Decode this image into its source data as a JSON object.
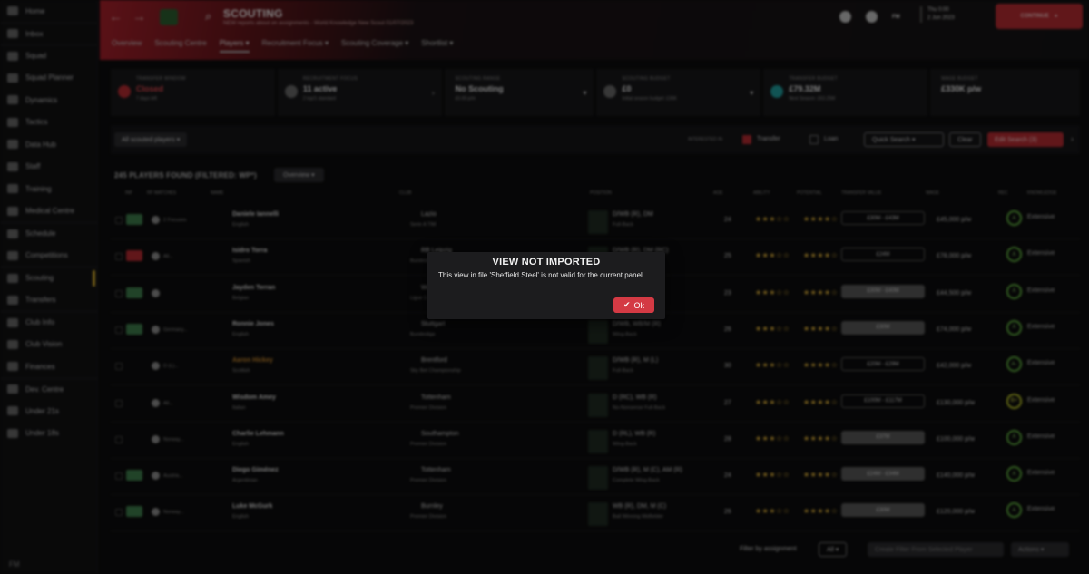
{
  "sidebar": {
    "items": [
      {
        "label": "Home",
        "icon": "home-icon"
      },
      {
        "label": "Inbox",
        "icon": "inbox-icon"
      },
      {
        "label": "Squad",
        "icon": "shirt-icon"
      },
      {
        "label": "Squad Planner",
        "icon": "planner-icon"
      },
      {
        "label": "Dynamics",
        "icon": "dynamics-icon"
      },
      {
        "label": "Tactics",
        "icon": "tactics-icon"
      },
      {
        "label": "Data Hub",
        "icon": "data-hub-icon"
      },
      {
        "label": "Staff",
        "icon": "staff-icon"
      },
      {
        "label": "Training",
        "icon": "training-icon"
      },
      {
        "label": "Medical Centre",
        "icon": "medical-icon"
      },
      {
        "label": "Schedule",
        "icon": "calendar-icon"
      },
      {
        "label": "Competitions",
        "icon": "trophy-icon"
      },
      {
        "label": "Scouting",
        "icon": "search-icon"
      },
      {
        "label": "Transfers",
        "icon": "transfers-icon"
      },
      {
        "label": "Club Info",
        "icon": "club-info-icon"
      },
      {
        "label": "Club Vision",
        "icon": "vision-icon"
      },
      {
        "label": "Finances",
        "icon": "finances-icon"
      },
      {
        "label": "Dev. Centre",
        "icon": "dev-centre-icon"
      },
      {
        "label": "Under 21s",
        "icon": "under21-icon"
      },
      {
        "label": "Under 18s",
        "icon": "under18-icon"
      }
    ],
    "footer": "FM"
  },
  "header": {
    "title": "SCOUTING",
    "subtitle": "NEW reports about on assignments - World Knowledge New Scout 01/07/2023",
    "abbr": "FM",
    "date_line1": "Thu 0:00",
    "date_line2": "2 Jun 2023",
    "continue_label": "CONTINUE"
  },
  "tabs": [
    "Overview",
    "Scouting Centre",
    "Players ▾",
    "Recruitment Focus ▾",
    "Scouting Coverage ▾",
    "Shortlist ▾"
  ],
  "cards": [
    {
      "label": "Transfer Window",
      "value": "Closed",
      "sub": "7 days left"
    },
    {
      "label": "Recruitment Focus",
      "value": "11 active",
      "sub": "2 top/1 standard"
    },
    {
      "label": "Scouting Range",
      "value": "No Scouting",
      "sub": "£0.00 p/m"
    },
    {
      "label": "Scouting Budget",
      "value": "£0",
      "sub": "Initial season budget: £36K"
    },
    {
      "label": "Transfer Budget",
      "value": "£79.32M",
      "sub": "Next Season: £63.25M"
    },
    {
      "label": "Wage Budget",
      "value": "£330K p/w",
      "sub": ""
    }
  ],
  "filters": {
    "all_scouted": "All scouted players ▾",
    "interested_in": "INTERESTED IN",
    "transfer": "Transfer",
    "loan": "Loan",
    "quick_search": "Quick Search ▾",
    "clear": "Clear",
    "edit_search": "Edit Search (3)"
  },
  "found_label": "245 PLAYERS FOUND (FILTERED: WP*)",
  "view_label": "Overview ▾",
  "columns": [
    "INF",
    "RF MATCHES",
    "NAME",
    "CLUB",
    "POSITION",
    "AGE",
    "ABILITY",
    "POTENTIAL",
    "TRANSFER VALUE",
    "WAGE",
    "REC",
    "KNOWLEDGE"
  ],
  "rows": [
    {
      "match": "2 Focuses",
      "name": "Daniele Iannelli",
      "nat": "English",
      "club": "Lazio",
      "league": "Serie A TIM",
      "pos": "D/WB (R), DM",
      "role": "Full-Back",
      "age": "24",
      "ability": "★★★☆☆",
      "potential": "★★★★☆",
      "value": "£30M - £43M",
      "wage": "£45,000 p/w",
      "rec": "A",
      "knowledge": "Extensive"
    },
    {
      "match": "All...",
      "name": "Isidro Torra",
      "nat": "Spanish",
      "club": "RB Leipzig",
      "league": "Bundesliga",
      "pos": "D/WB (R), DM (RC)",
      "role": "Full-Back",
      "age": "25",
      "ability": "★★★☆☆",
      "potential": "★★★★☆",
      "value": "£24M",
      "wage": "£78,000 p/w",
      "rec": "A",
      "knowledge": "Extensive"
    },
    {
      "match": "",
      "name": "Jayden Terran",
      "nat": "Belgian",
      "club": "Wolves",
      "league": "Ligue 1",
      "pos": "DM",
      "role": "Wing-Back",
      "age": "23",
      "ability": "★★★☆☆",
      "potential": "★★★★☆",
      "value": "£30M - £40M",
      "wage": "£44,500 p/w",
      "rec": "A",
      "knowledge": "Extensive"
    },
    {
      "match": "Germany...",
      "name": "Ronnie Jones",
      "nat": "English",
      "club": "Stuttgart",
      "league": "Bundesliga",
      "pos": "D/WB, WB/M (R)",
      "role": "Wing-Back",
      "age": "26",
      "ability": "★★★☆☆",
      "potential": "★★★★☆",
      "value": "£30M",
      "wage": "£74,000 p/w",
      "rec": "A",
      "knowledge": "Extensive"
    },
    {
      "match": "D (L)...",
      "name": "Aaron Hickey",
      "nat": "Scottish",
      "club": "Brentford",
      "league": "Sky Bet Championship",
      "pos": "D/WB (R), M (L)",
      "role": "Full-Back",
      "age": "30",
      "ability": "★★★☆☆",
      "potential": "★★★★☆",
      "value": "£20M - £29M",
      "wage": "£42,000 p/w",
      "rec": "A-",
      "knowledge": "Extensive"
    },
    {
      "match": "All...",
      "name": "Wisdom Amey",
      "nat": "Italian",
      "club": "Tottenham",
      "league": "Premier Division",
      "pos": "D (RC), WB (R)",
      "role": "No-Nonsense Full-Back",
      "age": "27",
      "ability": "★★★☆☆",
      "potential": "★★★★☆",
      "value": "£100M - £117M",
      "wage": "£130,000 p/w",
      "rec": "B+",
      "knowledge": "Extensive"
    },
    {
      "match": "Norway...",
      "name": "Charlie Lehmann",
      "nat": "English",
      "club": "Southampton",
      "league": "Premier Division",
      "pos": "D (RL), WB (R)",
      "role": "Wing-Back",
      "age": "28",
      "ability": "★★★☆☆",
      "potential": "★★★★☆",
      "value": "£37M",
      "wage": "£100,000 p/w",
      "rec": "A",
      "knowledge": "Extensive"
    },
    {
      "match": "Austria...",
      "name": "Diego Giménez",
      "nat": "Argentinian",
      "club": "Tottenham",
      "league": "Premier Division",
      "pos": "D/WB (R), M (C), AM (R)",
      "role": "Complete Wing-Back",
      "age": "24",
      "ability": "★★★☆☆",
      "potential": "★★★★☆",
      "value": "£24M - £34M",
      "wage": "£140,000 p/w",
      "rec": "A",
      "knowledge": "Extensive"
    },
    {
      "match": "Norway...",
      "name": "Luke McGurk",
      "nat": "English",
      "club": "Burnley",
      "league": "Premier Division",
      "pos": "WB (R), DM, M (C)",
      "role": "Ball Winning Midfielder",
      "age": "26",
      "ability": "★★★☆☆",
      "potential": "★★★★☆",
      "value": "£30M",
      "wage": "£120,000 p/w",
      "rec": "A",
      "knowledge": "Extensive"
    }
  ],
  "bottom": {
    "filter_label": "Filter by assignment",
    "all": "All ▾",
    "create_filter": "Create Filter From Selected Player",
    "actions": "Actions ▾"
  },
  "dialog": {
    "title": "VIEW NOT IMPORTED",
    "message": "This view in file 'Sheffield Steel' is not valid for the current panel",
    "ok_label": "Ok",
    "ok_icon": "check-icon",
    "accent": "#d43a44"
  }
}
